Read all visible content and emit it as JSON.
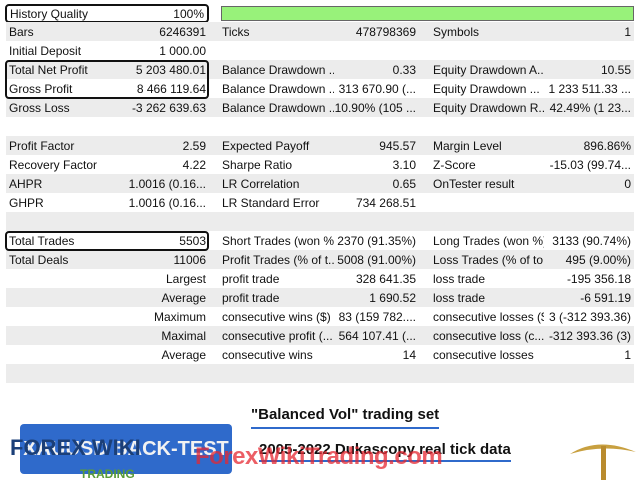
{
  "history_quality": {
    "label": "History Quality",
    "value": "100%",
    "fill_percent": 100
  },
  "rows": [
    [
      "Bars",
      "6246391",
      "Ticks",
      "478798369",
      "Symbols",
      "1"
    ],
    [
      "Initial Deposit",
      "1 000.00",
      "",
      "",
      "",
      ""
    ],
    [
      "Total Net Profit",
      "5 203 480.01",
      "Balance Drawdown ...",
      "0.33",
      "Equity Drawdown A...",
      "10.55"
    ],
    [
      "Gross Profit",
      "8 466 119.64",
      "Balance Drawdown ...",
      "313 670.90 (...",
      "Equity Drawdown ...",
      "1 233 511.33 ..."
    ],
    [
      "Gross Loss",
      "-3 262 639.63",
      "Balance Drawdown ...",
      "10.90% (105 ...",
      "Equity Drawdown R...",
      "42.49% (1 23..."
    ],
    [
      "",
      "",
      "",
      "",
      "",
      ""
    ],
    [
      "Profit Factor",
      "2.59",
      "Expected Payoff",
      "945.57",
      "Margin Level",
      "896.86%"
    ],
    [
      "Recovery Factor",
      "4.22",
      "Sharpe Ratio",
      "3.10",
      "Z-Score",
      "-15.03 (99.74..."
    ],
    [
      "AHPR",
      "1.0016 (0.16...",
      "LR Correlation",
      "0.65",
      "OnTester result",
      "0"
    ],
    [
      "GHPR",
      "1.0016 (0.16...",
      "LR Standard Error",
      "734 268.51",
      "",
      ""
    ],
    [
      "",
      "",
      "",
      "",
      "",
      ""
    ],
    [
      "Total Trades",
      "5503",
      "Short Trades (won %)",
      "2370 (91.35%)",
      "Long Trades (won %)",
      "3133 (90.74%)"
    ],
    [
      "Total Deals",
      "11006",
      "Profit Trades (% of t...",
      "5008 (91.00%)",
      "Loss Trades (% of to...",
      "495 (9.00%)"
    ],
    [
      "",
      "Largest",
      "profit trade",
      "328 641.35",
      "loss trade",
      "-195 356.18"
    ],
    [
      "",
      "Average",
      "profit trade",
      "1 690.52",
      "loss trade",
      "-6 591.19"
    ],
    [
      "",
      "Maximum",
      "consecutive wins ($)",
      "83 (159 782....",
      "consecutive losses ($)",
      "3 (-312 393.36)"
    ],
    [
      "",
      "Maximal",
      "consecutive profit (...",
      "564 107.41 (...",
      "consecutive loss (c...",
      "-312 393.36 (3)"
    ],
    [
      "",
      "Average",
      "consecutive wins",
      "14",
      "consecutive losses",
      "1"
    ],
    [
      "",
      "",
      "",
      "",
      "",
      ""
    ]
  ],
  "banner": {
    "badge": "XAUUSD BACK-TEST",
    "logo": "FOREX WIKI",
    "logo_sub": "TRADING",
    "line1": "\"Balanced Vol\" trading set",
    "line2": "2005-2022 Dukascopy real tick data",
    "watermark": "ForexWikiTrading.com"
  }
}
